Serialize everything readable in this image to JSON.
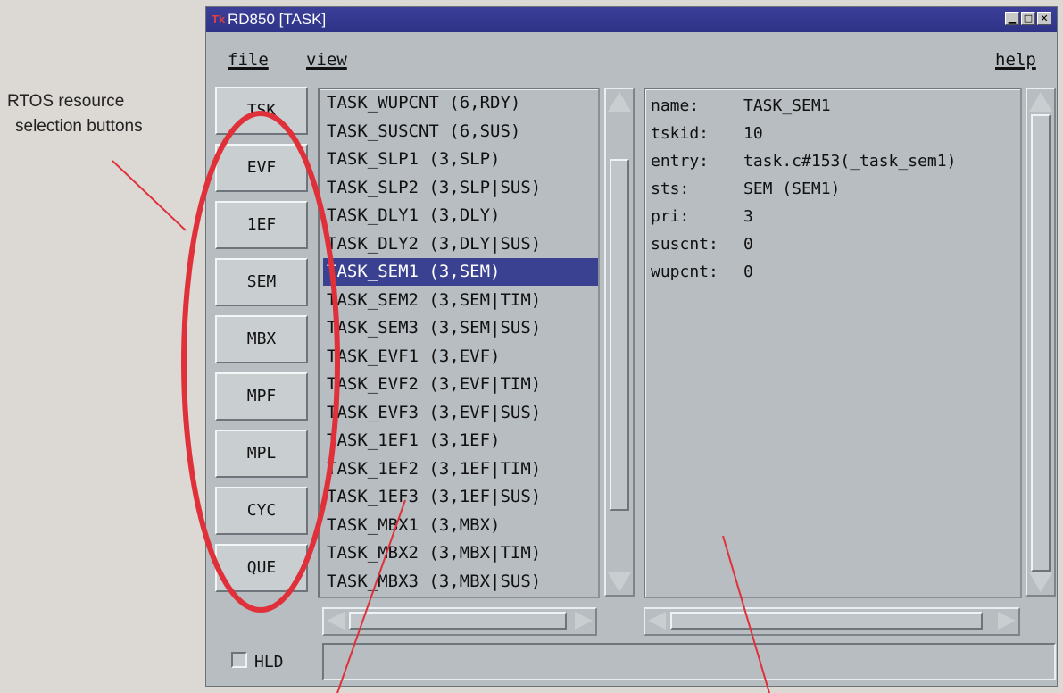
{
  "annotation": {
    "line1": "RTOS resource",
    "line2": "selection buttons"
  },
  "window": {
    "title": "RD850 [TASK]",
    "app_icon": "Tk",
    "controls": {
      "minimize": "▁",
      "maximize": "□",
      "close": "✕"
    }
  },
  "menu": {
    "file": "file",
    "view": "view",
    "help": "help"
  },
  "resource_buttons": [
    "TSK",
    "EVF",
    "1EF",
    "SEM",
    "MBX",
    "MPF",
    "MPL",
    "CYC",
    "QUE"
  ],
  "task_list": [
    "TASK_WUPCNT (6,RDY)",
    "TASK_SUSCNT (6,SUS)",
    "TASK_SLP1 (3,SLP)",
    "TASK_SLP2 (3,SLP|SUS)",
    "TASK_DLY1 (3,DLY)",
    "TASK_DLY2 (3,DLY|SUS)",
    "TASK_SEM1 (3,SEM)",
    "TASK_SEM2 (3,SEM|TIM)",
    "TASK_SEM3 (3,SEM|SUS)",
    "TASK_EVF1 (3,EVF)",
    "TASK_EVF2 (3,EVF|TIM)",
    "TASK_EVF3 (3,EVF|SUS)",
    "TASK_1EF1 (3,1EF)",
    "TASK_1EF2 (3,1EF|TIM)",
    "TASK_1EF3 (3,1EF|SUS)",
    "TASK_MBX1 (3,MBX)",
    "TASK_MBX2 (3,MBX|TIM)",
    "TASK_MBX3 (3,MBX|SUS)"
  ],
  "selected_task": "TASK_SEM1 (3,SEM)",
  "details": [
    {
      "key": "name:",
      "value": "TASK_SEM1"
    },
    {
      "key": "tskid:",
      "value": "10"
    },
    {
      "key": "entry:",
      "value": "task.c#153(_task_sem1)"
    },
    {
      "key": "sts:",
      "value": "SEM (SEM1)"
    },
    {
      "key": "pri:",
      "value": "3"
    },
    {
      "key": "suscnt:",
      "value": "0"
    },
    {
      "key": "wupcnt:",
      "value": "0"
    }
  ],
  "hold": {
    "label": "HLD",
    "checked": false
  },
  "status_text": "",
  "colors": {
    "titlebar": "#2e3387",
    "selection": "#3a4190",
    "window_bg": "#b7bdc1",
    "annotation": "#e0303a"
  }
}
